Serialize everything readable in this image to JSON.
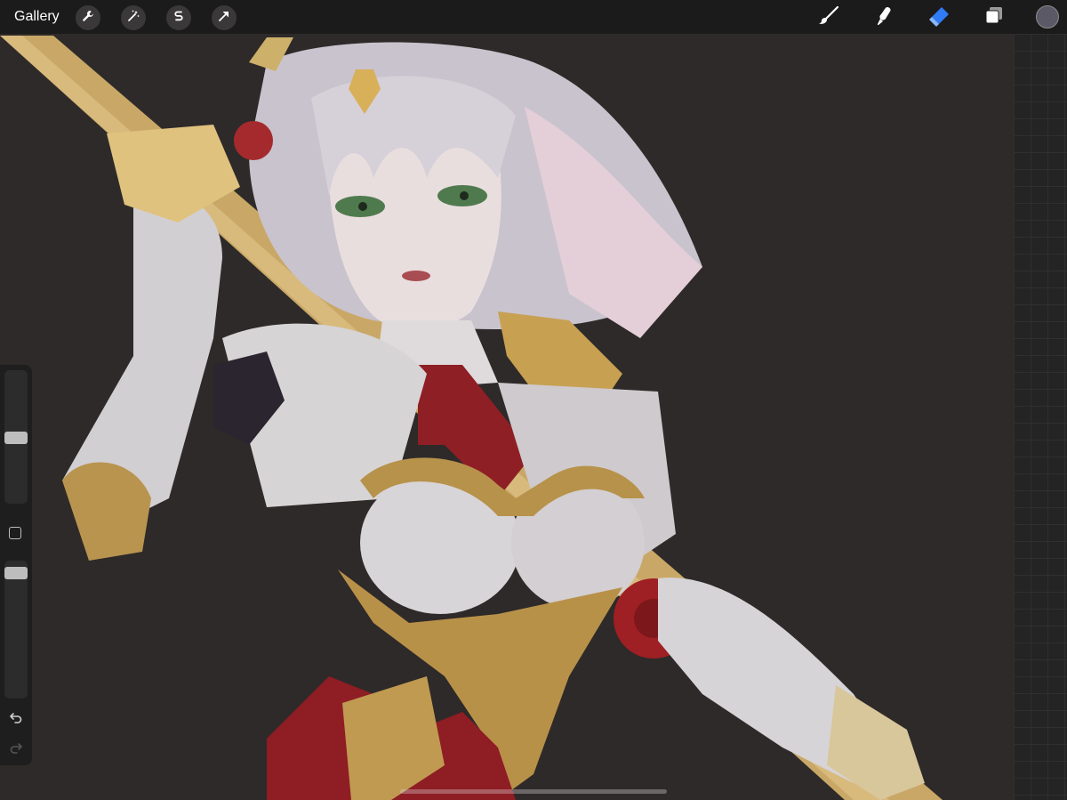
{
  "topbar": {
    "gallery_label": "Gallery",
    "actions": [
      {
        "icon": "wrench-icon"
      },
      {
        "icon": "magic-wand-icon"
      },
      {
        "icon": "selection-s-icon"
      },
      {
        "icon": "transform-arrow-icon"
      }
    ],
    "tools": [
      {
        "icon": "brush-icon",
        "active": false
      },
      {
        "icon": "smudge-icon",
        "active": false
      },
      {
        "icon": "eraser-icon",
        "active": true
      },
      {
        "icon": "layers-icon",
        "active": false
      }
    ],
    "active_tool_color": "#2f7cf6",
    "current_color": "#5c5966"
  },
  "sidebar": {
    "brush_size_level": 0.49,
    "opacity_level": 0.95
  },
  "canvas": {
    "background_color": "#2e2a29",
    "artwork": "digital-illustration"
  }
}
